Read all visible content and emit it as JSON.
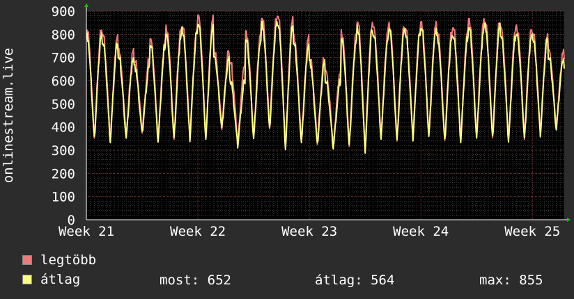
{
  "chart_data": {
    "type": "line",
    "ylabel": "onlinestream.live",
    "ylim": [
      0,
      900
    ],
    "yticks": [
      0,
      100,
      200,
      300,
      400,
      500,
      600,
      700,
      800,
      900
    ],
    "xlim": [
      0,
      30
    ],
    "xticks": [
      {
        "x": 0,
        "label": "Week 21"
      },
      {
        "x": 7,
        "label": "Week 22"
      },
      {
        "x": 14,
        "label": "Week 23"
      },
      {
        "x": 21,
        "label": "Week 24"
      },
      {
        "x": 28,
        "label": "Week 25"
      }
    ],
    "grid": true,
    "series": [
      {
        "name": "legtöbb",
        "color": "#f07a7a",
        "daily_peaks": [
          830,
          800,
          730,
          690,
          780,
          830,
          840,
          880,
          730,
          680,
          810,
          880,
          880,
          790,
          700,
          640,
          810,
          860,
          830,
          840,
          830,
          850,
          820,
          830,
          860,
          860,
          830,
          830,
          810,
          730
        ],
        "daily_troughs": [
          360,
          350,
          360,
          380,
          350,
          360,
          360,
          360,
          400,
          330,
          360,
          400,
          320,
          340,
          330,
          320,
          330,
          310,
          360,
          350,
          360,
          370,
          350,
          350,
          360,
          360,
          350,
          360,
          380,
          400
        ]
      },
      {
        "name": "átlag",
        "color": "#ffff80",
        "daily_peaks": [
          800,
          770,
          700,
          660,
          760,
          800,
          820,
          850,
          700,
          600,
          780,
          850,
          850,
          760,
          680,
          600,
          780,
          830,
          800,
          820,
          810,
          830,
          790,
          800,
          830,
          840,
          800,
          800,
          790,
          700
        ],
        "daily_troughs": [
          350,
          340,
          350,
          370,
          340,
          350,
          350,
          350,
          390,
          320,
          350,
          390,
          310,
          330,
          320,
          310,
          320,
          300,
          350,
          340,
          350,
          360,
          340,
          340,
          350,
          350,
          340,
          350,
          370,
          390
        ]
      }
    ],
    "end_value": 652
  },
  "legend": [
    {
      "label": "legtöbb",
      "color": "#f07a7a"
    },
    {
      "label": "átlag",
      "color": "#ffff80"
    }
  ],
  "stats": {
    "most": "most: 652",
    "atlag": "átlag: 564",
    "max": "max: 855"
  }
}
